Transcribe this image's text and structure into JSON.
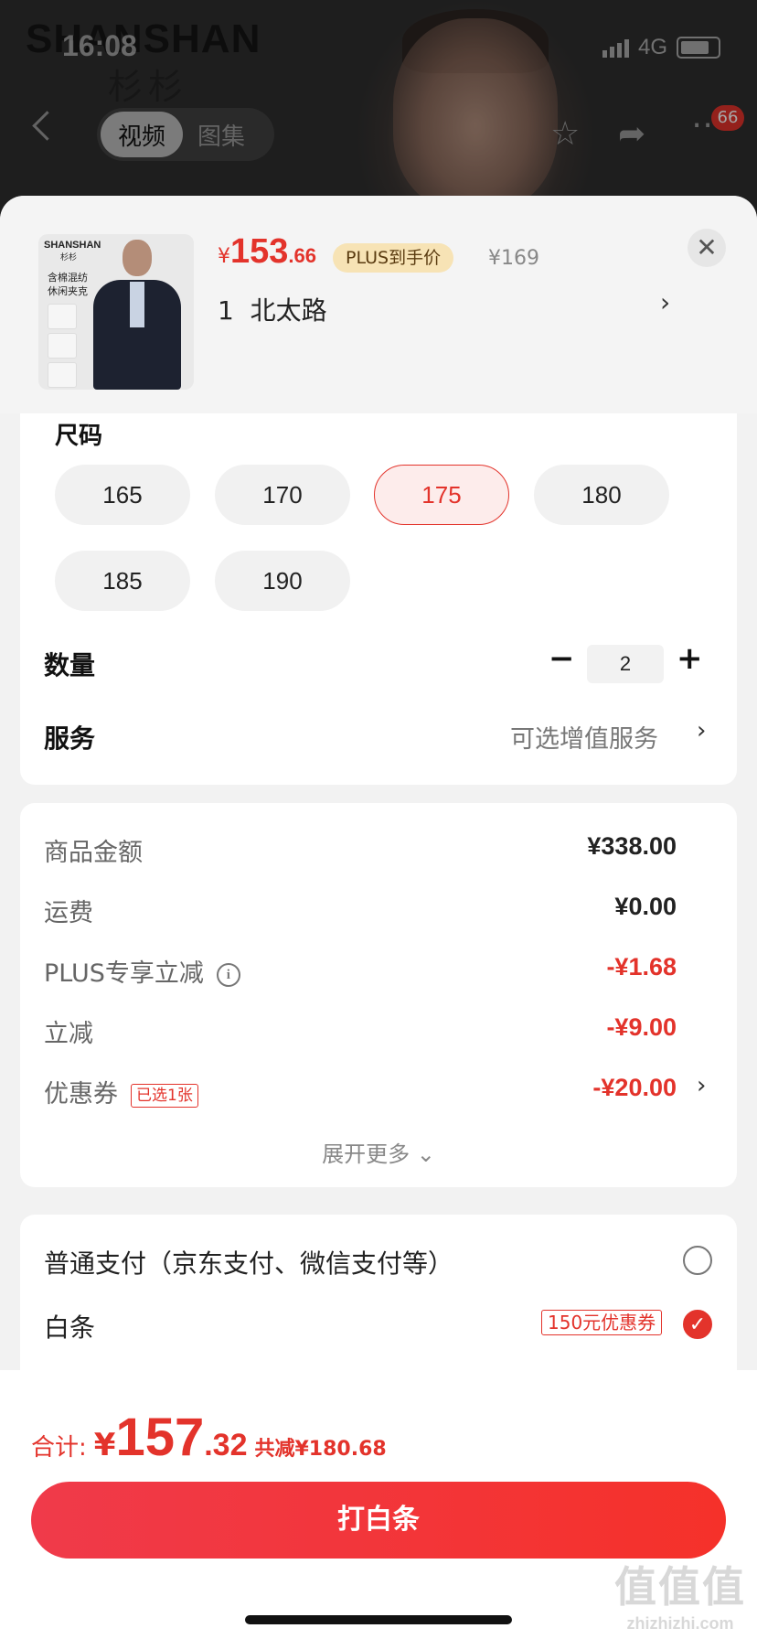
{
  "status_bar": {
    "time": "16:08",
    "network": "4G"
  },
  "background": {
    "brand": "SHANSHAN",
    "brand_cn": "杉杉"
  },
  "top_nav": {
    "tab_video": "视频",
    "tab_gallery": "图集",
    "cart_badge": "66"
  },
  "product": {
    "thumb_brand": "SHANSHAN",
    "thumb_brand_cn": "杉杉",
    "thumb_tagline": "含棉混纺\n休闲夹克",
    "price_symbol": "¥",
    "price_int": "153",
    "price_dec": ".66",
    "plus_tag": "PLUS到手价",
    "original_price": "¥169",
    "address": "1  北太路"
  },
  "options": {
    "size_title": "尺码",
    "sizes": [
      "165",
      "170",
      "175",
      "180",
      "185",
      "190"
    ],
    "selected_size": "175",
    "qty_label": "数量",
    "qty_minus": "−",
    "qty_value": "2",
    "qty_plus": "+",
    "service_label": "服务",
    "service_value": "可选增值服务"
  },
  "amounts": {
    "rows": [
      {
        "label": "商品金额",
        "value": "¥338.00"
      },
      {
        "label": "运费",
        "value": "¥0.00"
      },
      {
        "label": "PLUS专享立减",
        "value": "-¥1.68"
      },
      {
        "label": "立减",
        "value": "-¥9.00"
      },
      {
        "label": "优惠券",
        "value": "-¥20.00"
      }
    ],
    "coupon_tag": "已选1张",
    "expand_more": "展开更多"
  },
  "payment": {
    "normal_label": "普通支付（京东支付、微信支付等）",
    "baitiao_label": "白条",
    "baitiao_tag": "150元优惠券",
    "selected": "白条"
  },
  "footer": {
    "total_label": "合计:",
    "total_symbol": "¥",
    "total_int": "157",
    "total_dec": ".32",
    "total_saving": "共减¥180.68",
    "cta_label": "打白条"
  },
  "watermark": {
    "text": "值值值",
    "sub": "zhizhizhi.com"
  },
  "colors": {
    "accent": "#e3332b",
    "plus_tag_bg": "#f7e3b5"
  }
}
